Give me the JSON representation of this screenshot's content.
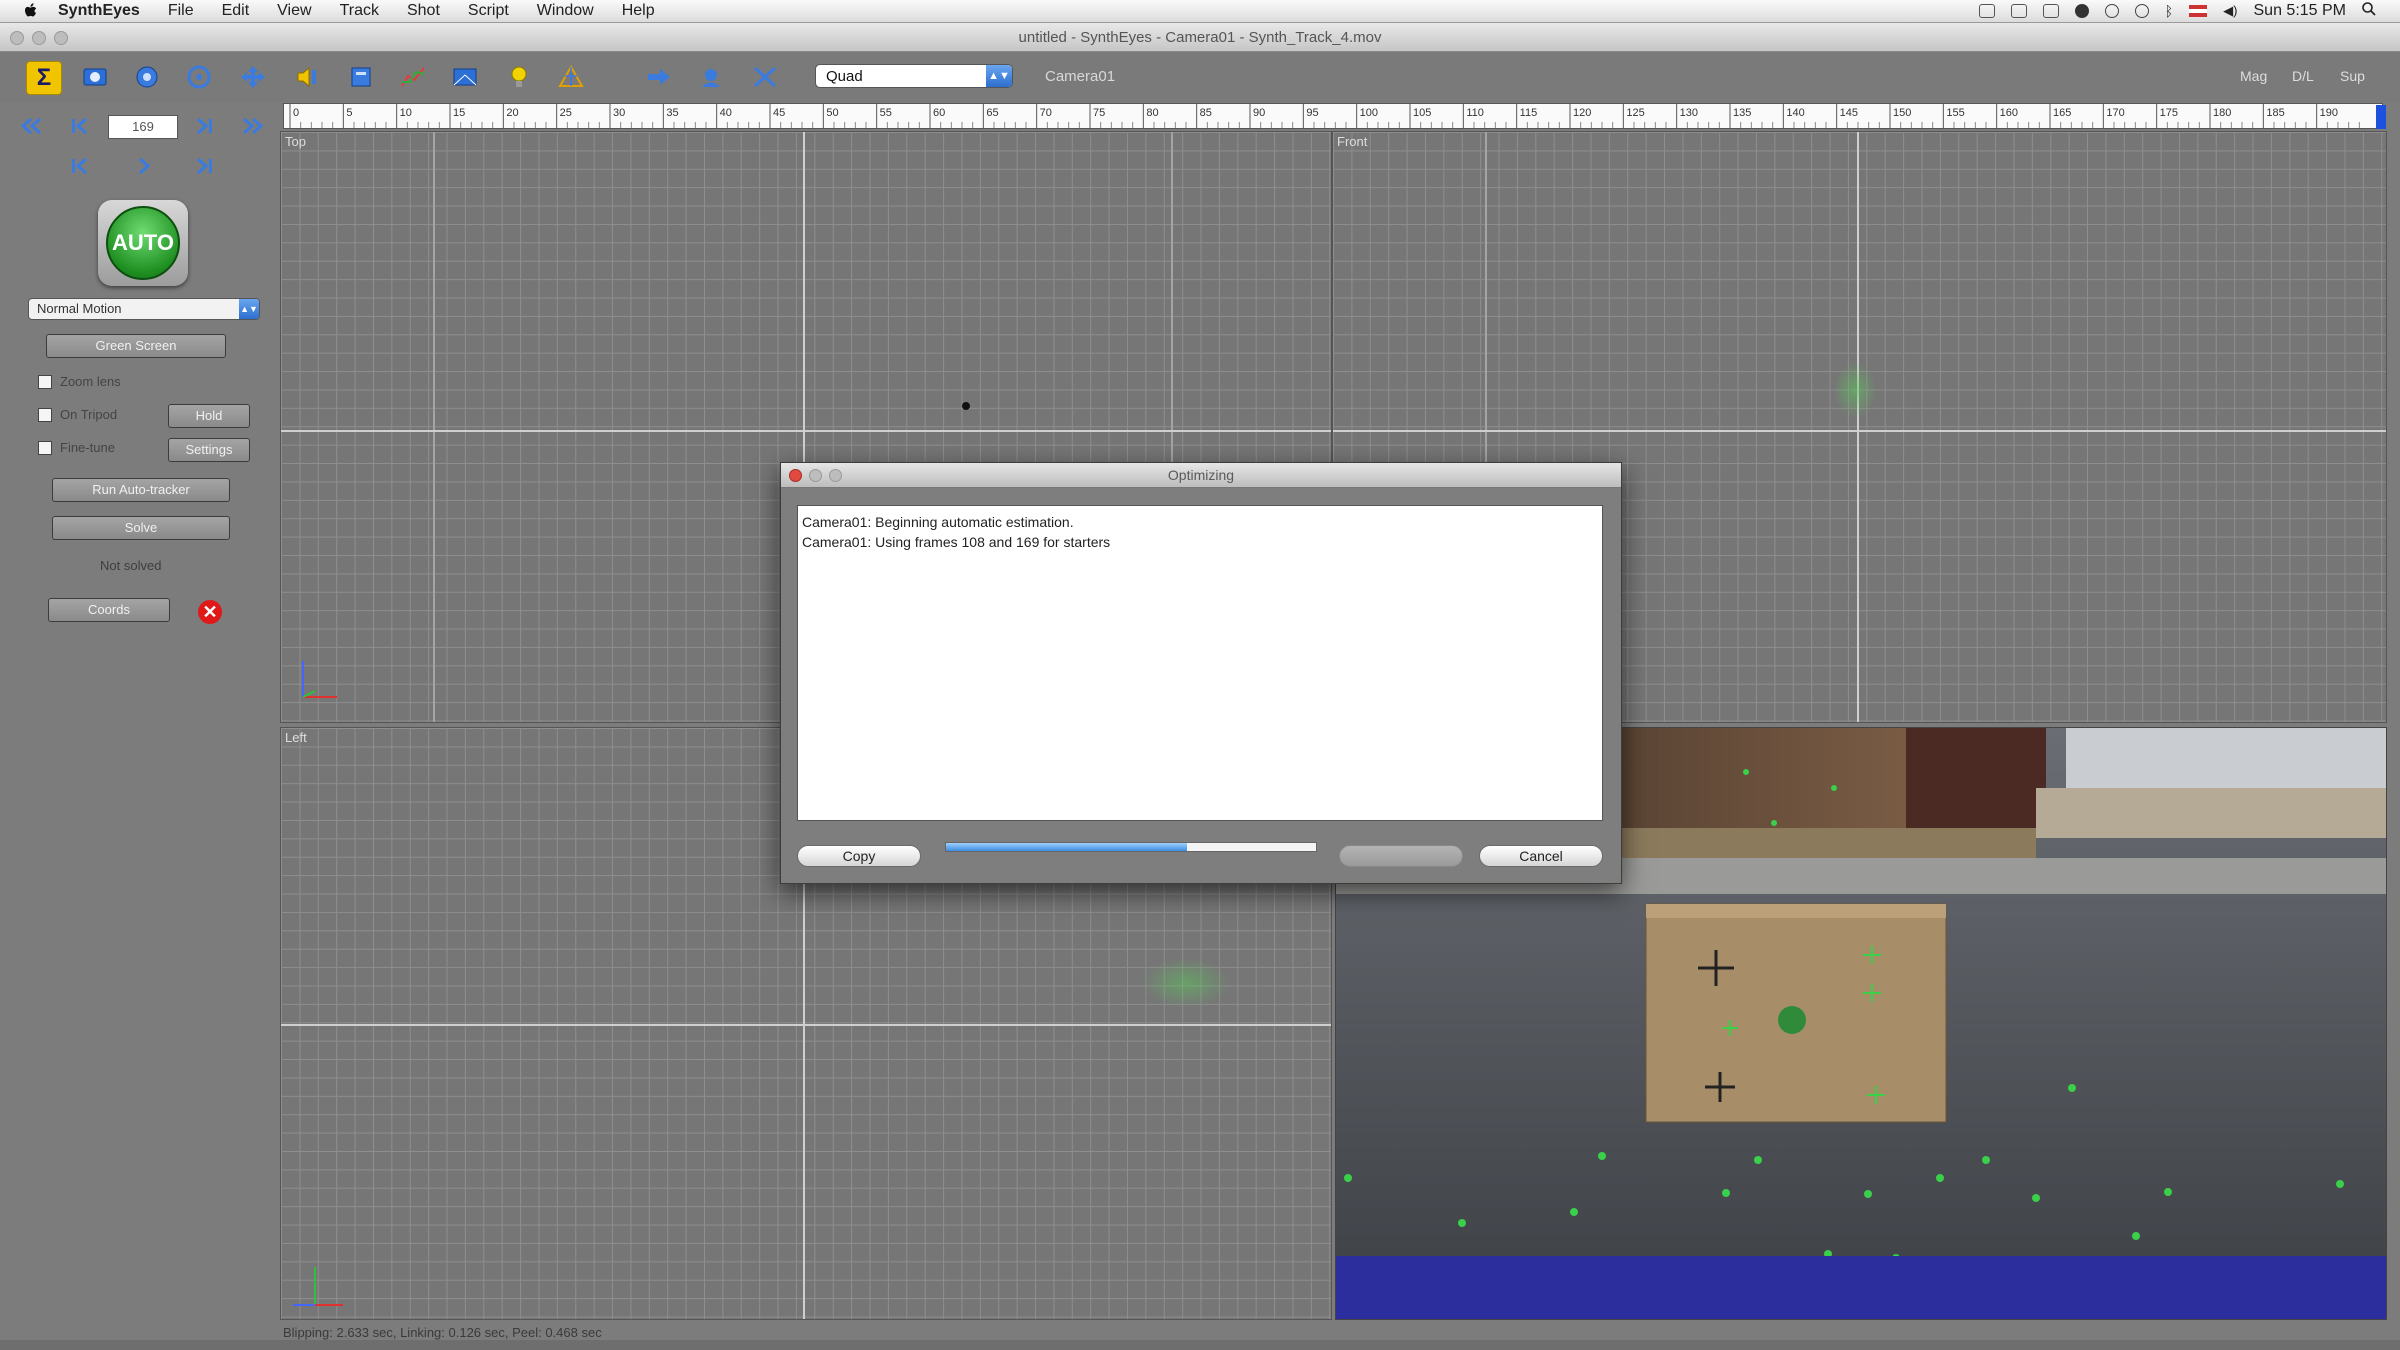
{
  "menubar": {
    "items": [
      "SynthEyes",
      "File",
      "Edit",
      "View",
      "Track",
      "Shot",
      "Script",
      "Window",
      "Help"
    ],
    "clock": "Sun 5:15 PM"
  },
  "window": {
    "title": "untitled - SynthEyes - Camera01 - Synth_Track_4.mov"
  },
  "toolbar": {
    "icons": [
      "summary-icon",
      "shot-icon",
      "camera-icon",
      "orbit-icon",
      "move-icon",
      "audio-icon",
      "solver-icon",
      "graph-icon",
      "perspective-icon",
      "light-icon",
      "mesh-icon",
      "arrow-icon",
      "tracker-icon",
      "cursor-cross-icon"
    ],
    "view_select": "Quad",
    "camera_label": "Camera01",
    "right_labels": [
      "Mag",
      "D/L",
      "Sup"
    ]
  },
  "left_panel": {
    "frame": "169",
    "auto_label": "AUTO",
    "motion_select": "Normal Motion",
    "green_screen": "Green Screen",
    "zoom_lens": "Zoom lens",
    "on_tripod": "On Tripod",
    "hold": "Hold",
    "fine_tune": "Fine-tune",
    "settings": "Settings",
    "run_auto_tracker": "Run Auto-tracker",
    "solve": "Solve",
    "not_solved": "Not solved",
    "coords": "Coords"
  },
  "timeline": {
    "ticks": [
      "0",
      "5",
      "10",
      "15",
      "20",
      "25",
      "30",
      "35",
      "40",
      "45",
      "50",
      "55",
      "60",
      "65",
      "70",
      "75",
      "80",
      "85",
      "90",
      "95",
      "100",
      "105",
      "110",
      "115",
      "120",
      "125",
      "130",
      "135",
      "140",
      "145",
      "150",
      "155",
      "160",
      "165",
      "170",
      "175",
      "180",
      "185",
      "190"
    ]
  },
  "viewports": {
    "top": "Top",
    "front": "Front",
    "left": "Left"
  },
  "dialog": {
    "title": "Optimizing",
    "log_lines": [
      "Camera01: Beginning automatic estimation.",
      "Camera01: Using frames 108 and 169 for starters"
    ],
    "copy": "Copy",
    "cancel": "Cancel",
    "progress": 0.65
  },
  "status_bar": "Blipping: 2.633 sec, Linking: 0.126 sec, Peel: 0.468 sec",
  "colors": {
    "accent": "#f1c400",
    "auto_green": "#1f8f22",
    "progress": "#3d8de0",
    "error": "#e01818",
    "tracker": "#3ad04a"
  }
}
